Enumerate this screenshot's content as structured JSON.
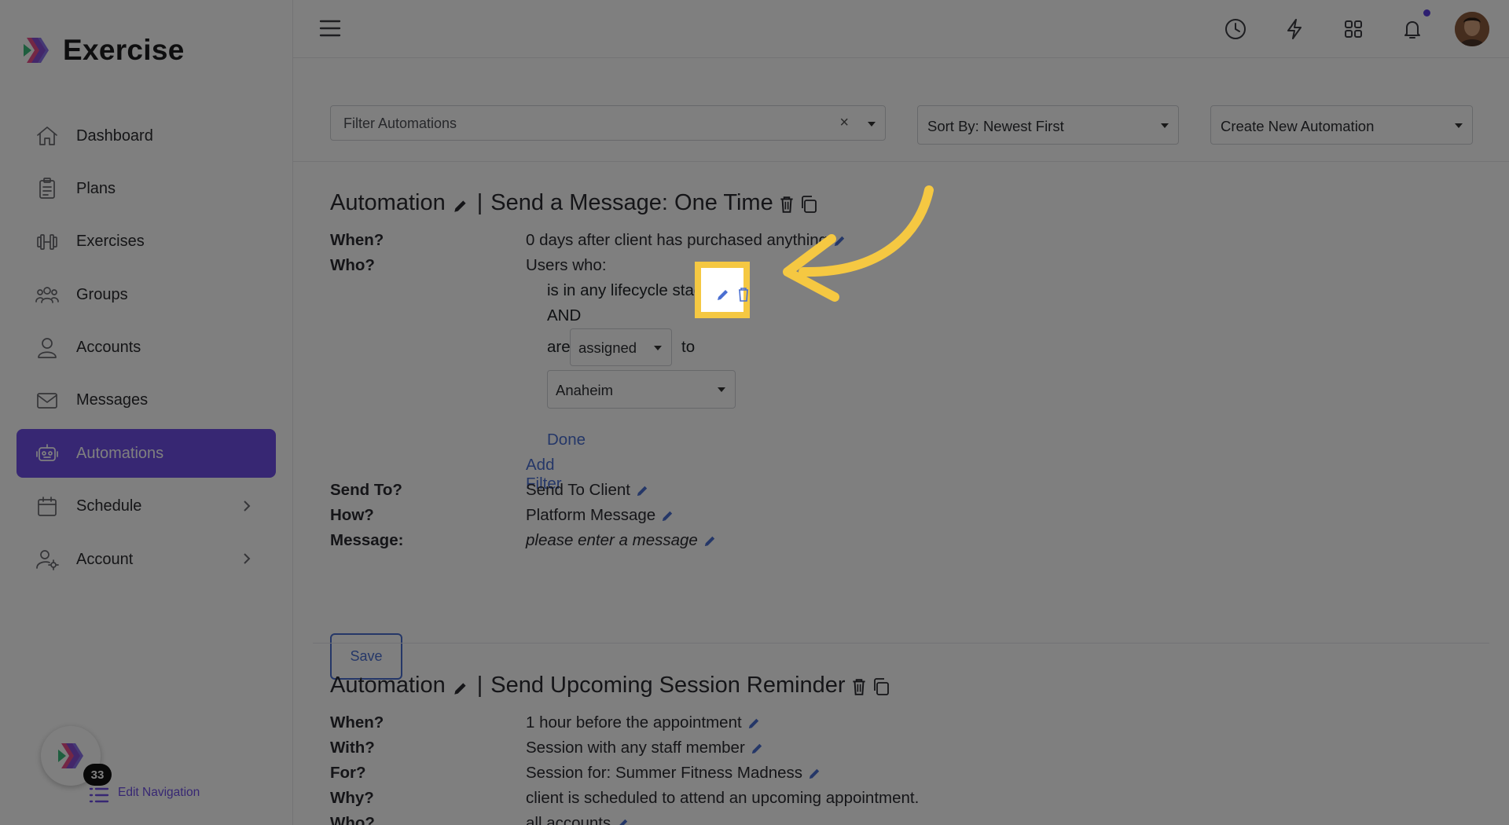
{
  "app": {
    "name": "Exercise"
  },
  "sidebar": {
    "items": [
      {
        "label": "Dashboard",
        "icon": "home-icon"
      },
      {
        "label": "Plans",
        "icon": "clipboard-icon"
      },
      {
        "label": "Exercises",
        "icon": "dumbbell-icon"
      },
      {
        "label": "Groups",
        "icon": "users-icon"
      },
      {
        "label": "Accounts",
        "icon": "user-icon"
      },
      {
        "label": "Messages",
        "icon": "mail-icon"
      },
      {
        "label": "Automations",
        "icon": "robot-icon",
        "active": true
      },
      {
        "label": "Schedule",
        "icon": "calendar-icon",
        "has_submenu": true
      },
      {
        "label": "Account",
        "icon": "user-cog-icon",
        "has_submenu": true
      }
    ],
    "edit_nav": {
      "badge": "33",
      "label": "Edit Navigation"
    }
  },
  "toolbar": {
    "filter_placeholder": "Filter Automations",
    "clear_glyph": "×",
    "sort_value": "Sort By: Newest First",
    "create_value": "Create New Automation"
  },
  "automation1": {
    "prefix": "Automation",
    "separator": "|",
    "name": "Send a Message: One Time",
    "when_label": "When?",
    "when_value": "0 days after client has purchased anything",
    "who_label": "Who?",
    "who_value": "Users who:",
    "filter1": "is in any lifecycle stage",
    "and_label": "AND",
    "are_label": "are",
    "assigned_value": "assigned",
    "to_label": "to",
    "location_value": "Anaheim",
    "done_label": "Done",
    "add_filter_label": "Add Filter",
    "send_to_label": "Send To?",
    "send_to_value": "Send To Client",
    "how_label": "How?",
    "how_value": "Platform Message",
    "message_label": "Message:",
    "message_value": "please enter a message",
    "save_label": "Save"
  },
  "automation2": {
    "prefix": "Automation",
    "separator": "|",
    "name": "Send Upcoming Session Reminder",
    "when_label": "When?",
    "when_value": "1 hour before the appointment",
    "with_label": "With?",
    "with_value": "Session with any staff member",
    "for_label": "For?",
    "for_value": "Session for: Summer Fitness Madness",
    "why_label": "Why?",
    "why_value": "client is scheduled to attend an upcoming appointment.",
    "who_label": "Who?",
    "who_value": "all accounts"
  },
  "colors": {
    "accent": "#6e4fe6",
    "link": "#4a6fd1",
    "highlight": "#f5c842"
  }
}
